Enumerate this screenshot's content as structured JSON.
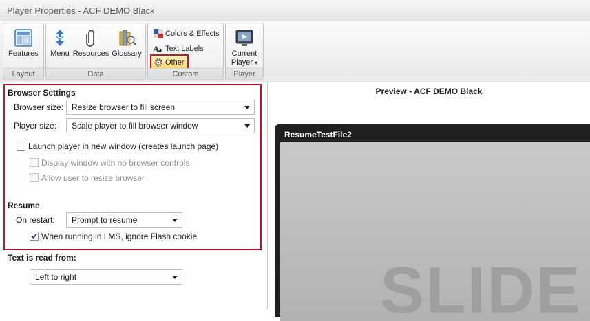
{
  "window": {
    "title": "Player Properties - ACF DEMO Black"
  },
  "ribbon": {
    "groups": {
      "layout": "Layout",
      "data": "Data",
      "custom": "Custom",
      "player": "Player"
    },
    "buttons": {
      "features": "Features",
      "menu": "Menu",
      "resources": "Resources",
      "glossary": "Glossary",
      "colors_effects": "Colors & Effects",
      "text_labels": "Text Labels",
      "other": "Other",
      "current_player_line1": "Current",
      "current_player_line2": "Player"
    },
    "icons": {
      "features": "layout-grid-icon",
      "menu": "menu-arrows-icon",
      "resources": "paperclip-icon",
      "glossary": "books-icon",
      "colors": "color-squares-icon",
      "text": "text-aa-icon",
      "other": "gear-icon",
      "player": "player-screen-icon"
    }
  },
  "browser_settings": {
    "title": "Browser Settings",
    "browser_size_label": "Browser size:",
    "browser_size_value": "Resize browser to fill screen",
    "player_size_label": "Player size:",
    "player_size_value": "Scale player to fill browser window",
    "launch_new_window": "Launch player in new window (creates launch page)",
    "launch_new_window_checked": false,
    "display_no_controls": "Display window with no browser controls",
    "allow_resize": "Allow user to resize browser"
  },
  "resume": {
    "title": "Resume",
    "on_restart_label": "On restart:",
    "on_restart_value": "Prompt to resume",
    "lms_ignore_flash": "When running in LMS, ignore Flash cookie",
    "lms_ignore_flash_checked": true
  },
  "text_direction": {
    "title": "Text is read from:",
    "value": "Left to right"
  },
  "preview": {
    "title": "Preview - ACF DEMO Black",
    "player_title": "ResumeTestFile2",
    "slide_watermark": "SLIDE"
  },
  "colors": {
    "highlight_border": "#c0182b",
    "player_frame": "#202020"
  }
}
